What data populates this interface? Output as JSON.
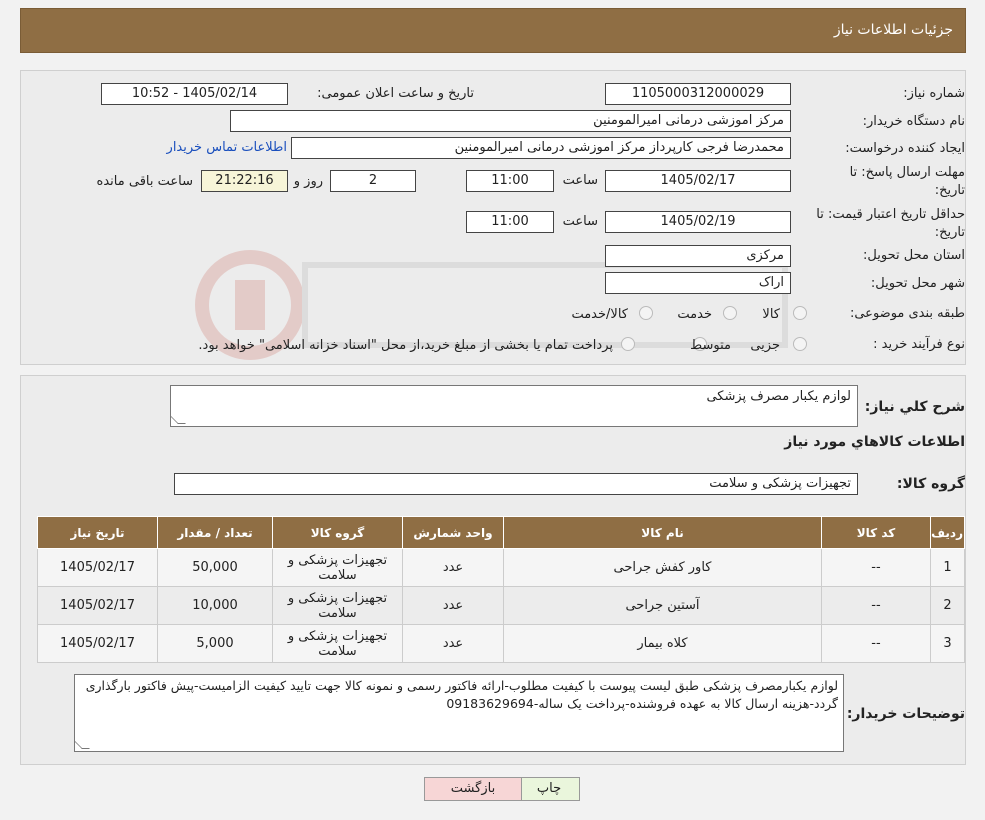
{
  "header": {
    "title": "جزئیات اطلاعات نیاز"
  },
  "form": {
    "need_number": {
      "label": "شماره نیاز:",
      "value": "1105000312000029"
    },
    "announce_datetime": {
      "label": "تاریخ و ساعت اعلان عمومی:",
      "value": "1405/02/14 - 10:52"
    },
    "buyer_org": {
      "label": "نام دستگاه خریدار:",
      "value": "مرکز اموزشی درمانی امیرالمومنین"
    },
    "requester": {
      "label": "ایجاد کننده درخواست:",
      "value": "محمدرضا فرجی کارپرداز مرکز اموزشی درمانی امیرالمومنین"
    },
    "contact_link": "اطلاعات تماس خریدار",
    "reply_deadline": {
      "label": "مهلت ارسال پاسخ: تا تاریخ:",
      "date": "1405/02/17",
      "time_label": "ساعت",
      "time": "11:00",
      "days": "2",
      "days_label": "روز و",
      "remaining": "21:22:16",
      "remaining_label": "ساعت باقی مانده"
    },
    "price_validity": {
      "label": "حداقل تاریخ اعتبار قیمت: تا تاریخ:",
      "date": "1405/02/19",
      "time_label": "ساعت",
      "time": "11:00"
    },
    "province": {
      "label": "استان محل تحویل:",
      "value": "مرکزی"
    },
    "city": {
      "label": "شهر محل تحویل:",
      "value": "اراک"
    },
    "category": {
      "label": "طبقه بندی موضوعی:",
      "options": [
        "کالا",
        "خدمت",
        "کالا/خدمت"
      ]
    },
    "process": {
      "label": "نوع فرآیند خرید :",
      "options": [
        "جزیی",
        "متوسط"
      ],
      "note": "پرداخت تمام یا بخشی از مبلغ خرید،از محل \"اسناد خزانه اسلامی\" خواهد بود."
    }
  },
  "summary": {
    "label": "شرح کلي نیاز:",
    "value": "لوازم یکبار مصرف پزشکی",
    "items_heading": "اطلاعات کالاهاي مورد نیاز",
    "group_label": "گروه کالا:",
    "group_value": "تجهیزات پزشکی و سلامت"
  },
  "table": {
    "headers": [
      "ردیف",
      "کد کالا",
      "نام کالا",
      "واحد شمارش",
      "گروه کالا",
      "تعداد / مقدار",
      "تاریخ نیاز"
    ],
    "rows": [
      {
        "idx": "1",
        "code": "--",
        "name": "کاور کفش جراحی",
        "unit": "عدد",
        "group": "تجهیزات پزشکی و سلامت",
        "qty": "50,000",
        "date": "1405/02/17"
      },
      {
        "idx": "2",
        "code": "--",
        "name": "آستین جراحی",
        "unit": "عدد",
        "group": "تجهیزات پزشکی و سلامت",
        "qty": "10,000",
        "date": "1405/02/17"
      },
      {
        "idx": "3",
        "code": "--",
        "name": "کلاه بیمار",
        "unit": "عدد",
        "group": "تجهیزات پزشکی و سلامت",
        "qty": "5,000",
        "date": "1405/02/17"
      }
    ]
  },
  "buyer_notes": {
    "label": "توضیحات خریدار:",
    "value": "لوازم یکبارمصرف پزشکی طبق لیست پیوست با کیفیت مطلوب-ارائه فاکتور رسمی و نمونه کالا جهت تایید کیفیت الزامیست-پیش فاکتور بارگذاری گردد-هزینه ارسال کالا به عهده فروشنده-پرداخت یک ساله-09183629694"
  },
  "buttons": {
    "print": "چاپ",
    "back": "بازگشت"
  },
  "colors": {
    "header_bg": "#8f6e44",
    "back_button_bg": "#f7d6d6",
    "print_button_bg": "#eaf6dc",
    "link": "#1a4fbd"
  }
}
